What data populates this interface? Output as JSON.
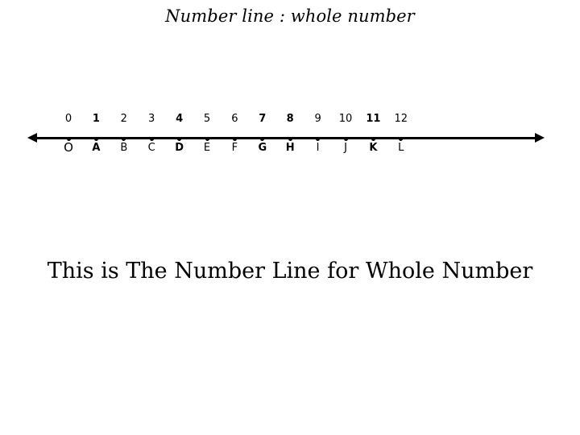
{
  "slide": {
    "title": "Number line : whole number",
    "caption": "This is The Number Line for Whole Number",
    "background_color": "#ffffff",
    "ink_color": "#000000"
  },
  "chart_data": {
    "type": "number-line",
    "title": "Number line : whole number",
    "caption": "This is The Number Line for Whole Number",
    "axis": {
      "min": 0,
      "max": 12,
      "step": 1,
      "left_arrow": true,
      "right_arrow": true,
      "grid": false
    },
    "points": [
      {
        "value": "0",
        "label": "O",
        "emphasis": false,
        "origin": true
      },
      {
        "value": "1",
        "label": "A",
        "emphasis": true,
        "origin": false
      },
      {
        "value": "2",
        "label": "B",
        "emphasis": false,
        "origin": false
      },
      {
        "value": "3",
        "label": "C",
        "emphasis": false,
        "origin": false
      },
      {
        "value": "4",
        "label": "D",
        "emphasis": true,
        "origin": false
      },
      {
        "value": "5",
        "label": "E",
        "emphasis": false,
        "origin": false
      },
      {
        "value": "6",
        "label": "F",
        "emphasis": false,
        "origin": false
      },
      {
        "value": "7",
        "label": "G",
        "emphasis": true,
        "origin": false
      },
      {
        "value": "8",
        "label": "H",
        "emphasis": true,
        "origin": false
      },
      {
        "value": "9",
        "label": "I",
        "emphasis": false,
        "origin": false
      },
      {
        "value": "10",
        "label": "J",
        "emphasis": false,
        "origin": false
      },
      {
        "value": "11",
        "label": "K",
        "emphasis": true,
        "origin": false
      },
      {
        "value": "12",
        "label": "L",
        "emphasis": false,
        "origin": false
      }
    ],
    "numbers_row": [
      "0",
      "1",
      "2",
      "3",
      "4",
      "5",
      "6",
      "7",
      "8",
      "9",
      "10",
      "11",
      "12"
    ],
    "letters_row": [
      "O",
      "A",
      "B",
      "C",
      "D",
      "E",
      "F",
      "G",
      "H",
      "I",
      "J",
      "K",
      "L"
    ]
  },
  "geometry": {
    "first_tick_x": 85,
    "tick_spacing": 34.4
  }
}
